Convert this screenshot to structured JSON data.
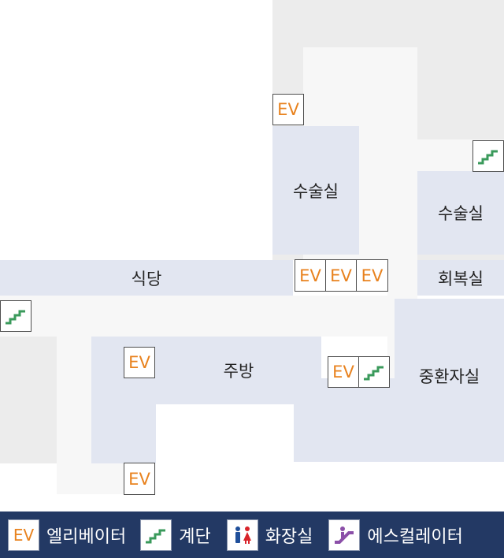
{
  "rooms": {
    "surgery_center": "수술실",
    "surgery_right": "수술실",
    "cafeteria": "식당",
    "recovery": "회복실",
    "kitchen": "주방",
    "icu": "중환자실"
  },
  "ev_label": "EV",
  "legend": {
    "ev_icon": "EV",
    "elevator": "엘리베이터",
    "stairs": "계단",
    "restroom": "화장실",
    "escalator": "에스컬레이터"
  },
  "colors": {
    "room_fill": "#e2e6f1",
    "corridor_fill": "#f7f7f7",
    "area_fill": "#ececec",
    "ev_text": "#e8821e",
    "stair_icon": "#3a9a5b",
    "legend_bar": "#233964",
    "restroom_male": "#1f4f9a",
    "restroom_female": "#d8232a",
    "escalator_icon": "#8b4fa8"
  },
  "icons": [
    "stairs-icon",
    "restroom-icon",
    "escalator-icon"
  ]
}
